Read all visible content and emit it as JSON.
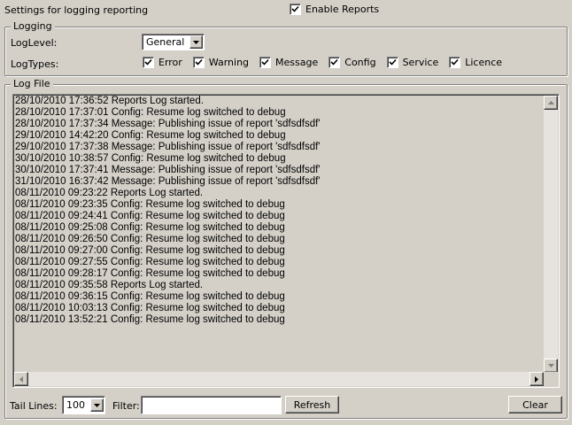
{
  "header": {
    "title": "Settings for logging reporting",
    "enable_reports_label": "Enable Reports",
    "enable_reports_checked": true
  },
  "logging": {
    "group_title": "Logging",
    "log_level_label": "LogLevel:",
    "log_level_value": "General",
    "log_types_label": "LogTypes:",
    "types": [
      {
        "label": "Error",
        "checked": true
      },
      {
        "label": "Warning",
        "checked": true
      },
      {
        "label": "Message",
        "checked": true
      },
      {
        "label": "Config",
        "checked": true
      },
      {
        "label": "Service",
        "checked": true
      },
      {
        "label": "Licence",
        "checked": true
      }
    ]
  },
  "log_file": {
    "group_title": "Log File",
    "lines": [
      "28/10/2010 17:36:52 Reports Log started.",
      "28/10/2010 17:37:01 Config: Resume log switched to debug",
      "28/10/2010 17:37:34 Message: Publishing issue of report 'sdfsdfsdf'",
      "29/10/2010 14:42:20 Config: Resume log switched to debug",
      "29/10/2010 17:37:38 Message: Publishing issue of report 'sdfsdfsdf'",
      "30/10/2010 10:38:57 Config: Resume log switched to debug",
      "30/10/2010 17:37:41 Message: Publishing issue of report 'sdfsdfsdf'",
      "31/10/2010 16:37:42 Message: Publishing issue of report 'sdfsdfsdf'",
      "08/11/2010 09:23:22 Reports Log started.",
      "08/11/2010 09:23:35 Config: Resume log switched to debug",
      "08/11/2010 09:24:41 Config: Resume log switched to debug",
      "08/11/2010 09:25:08 Config: Resume log switched to debug",
      "08/11/2010 09:26:50 Config: Resume log switched to debug",
      "08/11/2010 09:27:00 Config: Resume log switched to debug",
      "08/11/2010 09:27:55 Config: Resume log switched to debug",
      "08/11/2010 09:28:17 Config: Resume log switched to debug",
      "08/11/2010 09:35:58 Reports Log started.",
      "08/11/2010 09:36:15 Config: Resume log switched to debug",
      "08/11/2010 10:03:13 Config: Resume log switched to debug",
      "08/11/2010 13:52:21 Config: Resume log switched to debug"
    ],
    "tail_lines_label": "Tail Lines:",
    "tail_lines_value": "100",
    "filter_label": "Filter:",
    "filter_value": "",
    "refresh_label": "Refresh",
    "clear_label": "Clear"
  }
}
